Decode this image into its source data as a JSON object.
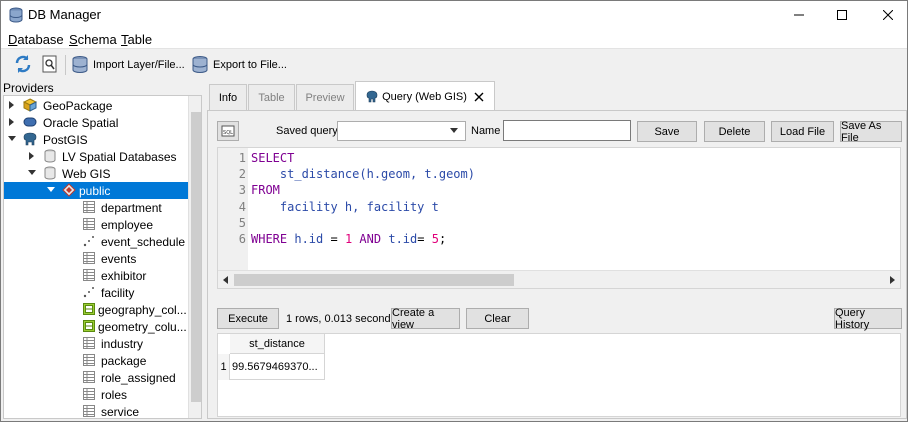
{
  "window": {
    "title": "DB Manager"
  },
  "menu": [
    {
      "label": "Database",
      "mnemonic": "D",
      "rest": "atabase"
    },
    {
      "label": "Schema",
      "mnemonic": "S",
      "rest": "chema"
    },
    {
      "label": "Table",
      "mnemonic": "T",
      "rest": "able"
    }
  ],
  "toolbar": {
    "import_label": "Import Layer/File...",
    "export_label": "Export to File..."
  },
  "providers": {
    "label": "Providers",
    "tree": [
      {
        "label": "GeoPackage",
        "icon": "geopackage-icon"
      },
      {
        "label": "Oracle Spatial",
        "icon": "oracle-icon"
      },
      {
        "label": "PostGIS",
        "icon": "postgis-elephant-icon"
      },
      {
        "label": "LV Spatial Databases",
        "icon": "database-icon"
      },
      {
        "label": "Web GIS",
        "icon": "database-icon"
      },
      {
        "label": "public",
        "icon": "schema-icon"
      },
      {
        "label": "department",
        "icon": "table-icon"
      },
      {
        "label": "employee",
        "icon": "table-icon"
      },
      {
        "label": "event_schedule",
        "icon": "point-layer-icon"
      },
      {
        "label": "events",
        "icon": "table-icon"
      },
      {
        "label": "exhibitor",
        "icon": "table-icon"
      },
      {
        "label": "facility",
        "icon": "point-layer-icon"
      },
      {
        "label": "geography_col...",
        "icon": "view-icon"
      },
      {
        "label": "geometry_colu...",
        "icon": "view-icon"
      },
      {
        "label": "industry",
        "icon": "table-icon"
      },
      {
        "label": "package",
        "icon": "table-icon"
      },
      {
        "label": "role_assigned",
        "icon": "table-icon"
      },
      {
        "label": "roles",
        "icon": "table-icon"
      },
      {
        "label": "service",
        "icon": "table-icon"
      }
    ]
  },
  "tabs": {
    "info": "Info",
    "table": "Table",
    "preview": "Preview",
    "query": "Query (Web GIS)"
  },
  "query": {
    "saved_query_label": "Saved query",
    "name_label": "Name",
    "save": "Save",
    "delete": "Delete",
    "load_file": "Load File",
    "save_as_file": "Save As File",
    "code_lines": [
      "1",
      "2",
      "3",
      "4",
      "5",
      "6"
    ],
    "execute": "Execute",
    "status": "1 rows, 0.013 seconds",
    "create_view": "Create a view",
    "clear": "Clear",
    "query_history": "Query History"
  },
  "results": {
    "columns": [
      "st_distance"
    ],
    "row_numbers": [
      "1"
    ],
    "rows": [
      [
        "99.5679469370..."
      ]
    ]
  },
  "colors": {
    "selection": "#0078d7",
    "keyword": "#7f0055",
    "number": "#e0007a",
    "identifier": "#2b4aa8"
  }
}
